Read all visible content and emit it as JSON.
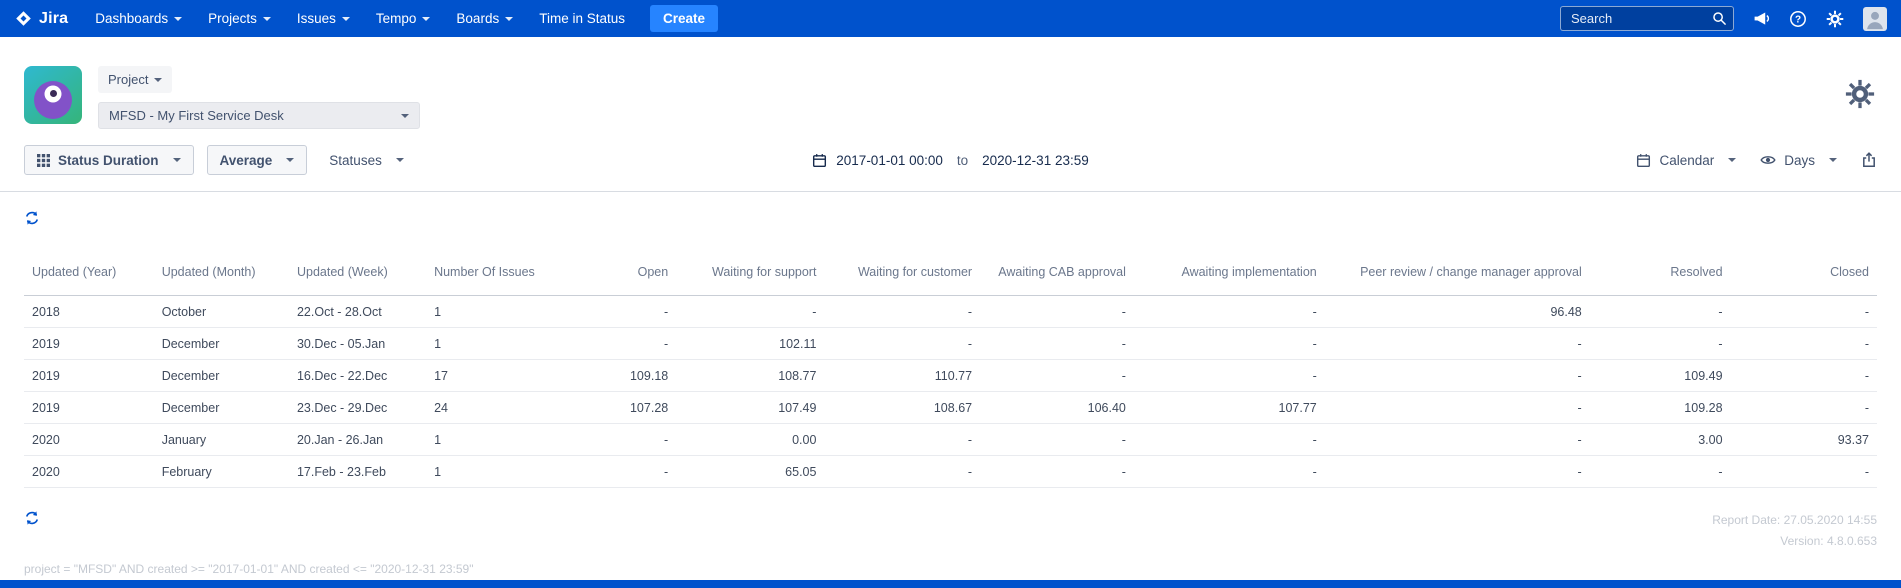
{
  "ui": {
    "colors": {
      "nav_blue": "#0052CC",
      "create_blue": "#2684FF",
      "accent_blue": "#0052CC"
    }
  },
  "navbar": {
    "brand": "Jira",
    "items": [
      {
        "label": "Dashboards"
      },
      {
        "label": "Projects"
      },
      {
        "label": "Issues"
      },
      {
        "label": "Tempo"
      },
      {
        "label": "Boards"
      },
      {
        "label": "Time in Status"
      }
    ],
    "create_label": "Create",
    "search_placeholder": "Search"
  },
  "project_bar": {
    "scope_label": "Project",
    "selected_project": "MFSD - My First Service Desk"
  },
  "toolbar": {
    "report_type_label": "Status Duration",
    "metric_label": "Average",
    "statuses_label": "Statuses",
    "date_from": "2017-01-01 00:00",
    "date_separator": "to",
    "date_to": "2020-12-31 23:59",
    "calendar_label": "Calendar",
    "unit_label": "Days"
  },
  "table": {
    "columns": [
      "Updated (Year)",
      "Updated (Month)",
      "Updated (Week)",
      "Number Of Issues",
      "Open",
      "Waiting for support",
      "Waiting for customer",
      "Awaiting CAB approval",
      "Awaiting implementation",
      "Peer review / change manager approval",
      "Resolved",
      "Closed"
    ],
    "rows": [
      [
        "2018",
        "October",
        "22.Oct - 28.Oct",
        "1",
        "-",
        "-",
        "-",
        "-",
        "-",
        "96.48",
        "-",
        "-"
      ],
      [
        "2019",
        "December",
        "30.Dec - 05.Jan",
        "1",
        "-",
        "102.11",
        "-",
        "-",
        "-",
        "-",
        "-",
        "-"
      ],
      [
        "2019",
        "December",
        "16.Dec - 22.Dec",
        "17",
        "109.18",
        "108.77",
        "110.77",
        "-",
        "-",
        "-",
        "109.49",
        "-"
      ],
      [
        "2019",
        "December",
        "23.Dec - 29.Dec",
        "24",
        "107.28",
        "107.49",
        "108.67",
        "106.40",
        "107.77",
        "-",
        "109.28",
        "-"
      ],
      [
        "2020",
        "January",
        "20.Jan - 26.Jan",
        "1",
        "-",
        "0.00",
        "-",
        "-",
        "-",
        "-",
        "3.00",
        "93.37"
      ],
      [
        "2020",
        "February",
        "17.Feb - 23.Feb",
        "1",
        "-",
        "65.05",
        "-",
        "-",
        "-",
        "-",
        "-",
        "-"
      ]
    ]
  },
  "footer": {
    "report_date": "Report Date: 27.05.2020 14:55",
    "version": "Version: 4.8.0.653",
    "query": "project = \"MFSD\" AND created >= \"2017-01-01\" AND created <= \"2020-12-31 23:59\""
  }
}
